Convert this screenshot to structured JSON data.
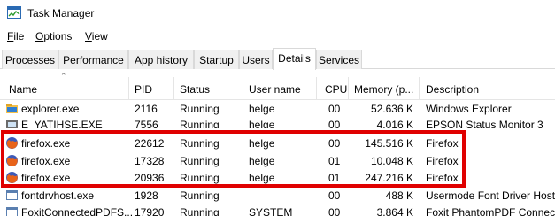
{
  "window": {
    "title": "Task Manager"
  },
  "menu": [
    {
      "underline": "F",
      "rest": "ile"
    },
    {
      "underline": "O",
      "rest": "ptions"
    },
    {
      "underline": "V",
      "rest": "iew"
    }
  ],
  "tabs": [
    "Processes",
    "Performance",
    "App history",
    "Startup",
    "Users",
    "Details",
    "Services"
  ],
  "active_tab": "Details",
  "columns": {
    "name": "Name",
    "pid": "PID",
    "status": "Status",
    "user": "User name",
    "cpu": "CPU",
    "memory": "Memory (p...",
    "description": "Description"
  },
  "rows": [
    {
      "icon": "folder-icon",
      "name": "explorer.exe",
      "pid": "2116",
      "status": "Running",
      "user": "helge",
      "cpu": "00",
      "memory": "52.636 K",
      "description": "Windows Explorer"
    },
    {
      "icon": "printer-monitor-icon",
      "name": "E_YATIHSE.EXE",
      "pid": "7556",
      "status": "Running",
      "user": "helge",
      "cpu": "00",
      "memory": "4.016 K",
      "description": "EPSON Status Monitor 3"
    },
    {
      "icon": "firefox-icon",
      "name": "firefox.exe",
      "pid": "22612",
      "status": "Running",
      "user": "helge",
      "cpu": "00",
      "memory": "145.516 K",
      "description": "Firefox"
    },
    {
      "icon": "firefox-icon",
      "name": "firefox.exe",
      "pid": "17328",
      "status": "Running",
      "user": "helge",
      "cpu": "01",
      "memory": "10.048 K",
      "description": "Firefox"
    },
    {
      "icon": "firefox-icon",
      "name": "firefox.exe",
      "pid": "20936",
      "status": "Running",
      "user": "helge",
      "cpu": "01",
      "memory": "247.216 K",
      "description": "Firefox"
    },
    {
      "icon": "app-window-icon",
      "name": "fontdrvhost.exe",
      "pid": "1928",
      "status": "Running",
      "user": "",
      "cpu": "00",
      "memory": "488 K",
      "description": "Usermode Font Driver Host"
    },
    {
      "icon": "app-window-icon",
      "name": "FoxitConnectedPDFS...",
      "pid": "17920",
      "status": "Running",
      "user": "SYSTEM",
      "cpu": "00",
      "memory": "3.864 K",
      "description": "Foxit PhantomPDF Connec"
    }
  ],
  "colors": {
    "highlight": "#e00000",
    "firefox_orange": "#e8631a",
    "firefox_blue": "#3d5ab8"
  }
}
